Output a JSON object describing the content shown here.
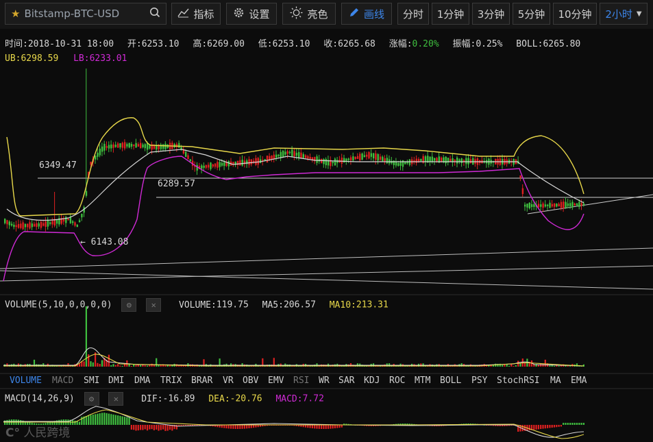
{
  "toolbar": {
    "symbol": "Bitstamp-BTC-USD",
    "indicators": "指标",
    "settings": "设置",
    "brightness": "亮色",
    "draw": "画线",
    "timeframes": [
      "分时",
      "1分钟",
      "3分钟",
      "5分钟",
      "10分钟"
    ],
    "active_timeframe": "2小时"
  },
  "info": {
    "time_label": "时间:",
    "time": "2018-10-31 18:00",
    "open_label": "开:",
    "open": "6253.10",
    "high_label": "高:",
    "high": "6269.00",
    "low_label": "低:",
    "low": "6253.10",
    "close_label": "收:",
    "close": "6265.68",
    "change_label": "涨幅:",
    "change": "0.20%",
    "amp_label": "振幅:",
    "amp": "0.25%",
    "boll_label": "BOLL:",
    "boll": "6265.80",
    "ub_label": "UB:",
    "ub": "6298.59",
    "lb_label": "LB:",
    "lb": "6233.01"
  },
  "price_marks": {
    "high_mark": "6349.47",
    "mid_mark": "6289.57",
    "low_mark": "← 6143.08"
  },
  "volume": {
    "title": "VOLUME(5,10,0,0,0,0)",
    "vol_label": "VOLUME:",
    "vol": "119.75",
    "ma5_label": "MA5:",
    "ma5": "206.57",
    "ma10_label": "MA10:",
    "ma10": "213.31"
  },
  "indicator_tabs": [
    "VOLUME",
    "MACD",
    "SMI",
    "DMI",
    "DMA",
    "TRIX",
    "BRAR",
    "VR",
    "OBV",
    "EMV",
    "RSI",
    "WR",
    "SAR",
    "KDJ",
    "ROC",
    "MTM",
    "BOLL",
    "PSY",
    "StochRSI",
    "MA",
    "EMA"
  ],
  "macd": {
    "title": "MACD(14,26,9)",
    "dif_label": "DIF:",
    "dif": "-16.89",
    "dea_label": "DEA:",
    "dea": "-20.76",
    "macd_label": "MACD:",
    "macd": "7.72"
  },
  "watermark": "人民跨境",
  "colors": {
    "up": "#3fbf3f",
    "down": "#e02020",
    "boll_upper": "#e8d84a",
    "boll_lower": "#d02ad6",
    "boll_mid": "#d8d8d8",
    "accent": "#3d86ea"
  }
}
